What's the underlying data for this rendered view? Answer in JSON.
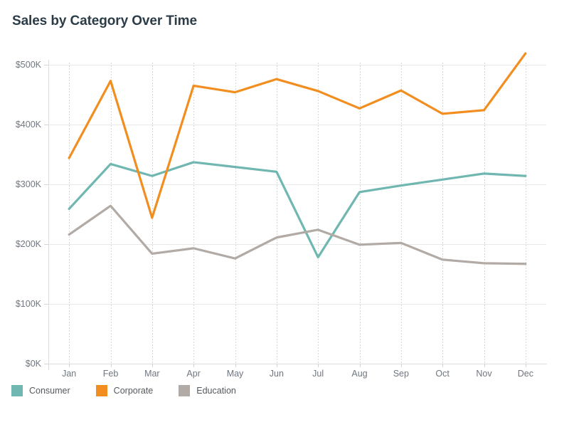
{
  "chart_data": {
    "type": "line",
    "title": "Sales by Category Over Time",
    "xlabel": "",
    "ylabel": "",
    "categories": [
      "Jan",
      "Feb",
      "Mar",
      "Apr",
      "May",
      "Jun",
      "Jul",
      "Aug",
      "Sep",
      "Oct",
      "Nov",
      "Dec"
    ],
    "ylim": [
      0,
      500000
    ],
    "ytick_values": [
      0,
      100000,
      200000,
      300000,
      400000,
      500000
    ],
    "ytick_labels": [
      "$0K",
      "$100K",
      "$200K",
      "$300K",
      "$400K",
      "$500K"
    ],
    "grid": {
      "horizontal": true,
      "vertical": true,
      "vertical_style": "dotted"
    },
    "legend_position": "bottom-left",
    "series": [
      {
        "name": "Consumer",
        "color": "#6fb7b0",
        "values": [
          259000,
          334000,
          314000,
          337000,
          329000,
          321000,
          178000,
          287000,
          298000,
          308000,
          318000,
          314000
        ]
      },
      {
        "name": "Corporate",
        "color": "#f28e1f",
        "values": [
          344000,
          473000,
          244000,
          465000,
          454000,
          476000,
          456000,
          427000,
          457000,
          418000,
          424000,
          519000
        ]
      },
      {
        "name": "Education",
        "color": "#b2aaa5",
        "values": [
          216000,
          264000,
          184000,
          193000,
          176000,
          211000,
          224000,
          199000,
          202000,
          174000,
          168000,
          167000
        ]
      }
    ]
  },
  "colors": {
    "title": "#2c3c46",
    "tick_label": "#6f7680",
    "legend_label": "#54595f",
    "grid_horizontal": "#e9e9e9",
    "grid_vertical": "#d8d8d8",
    "axis": "#dddddd",
    "background": "#ffffff"
  }
}
